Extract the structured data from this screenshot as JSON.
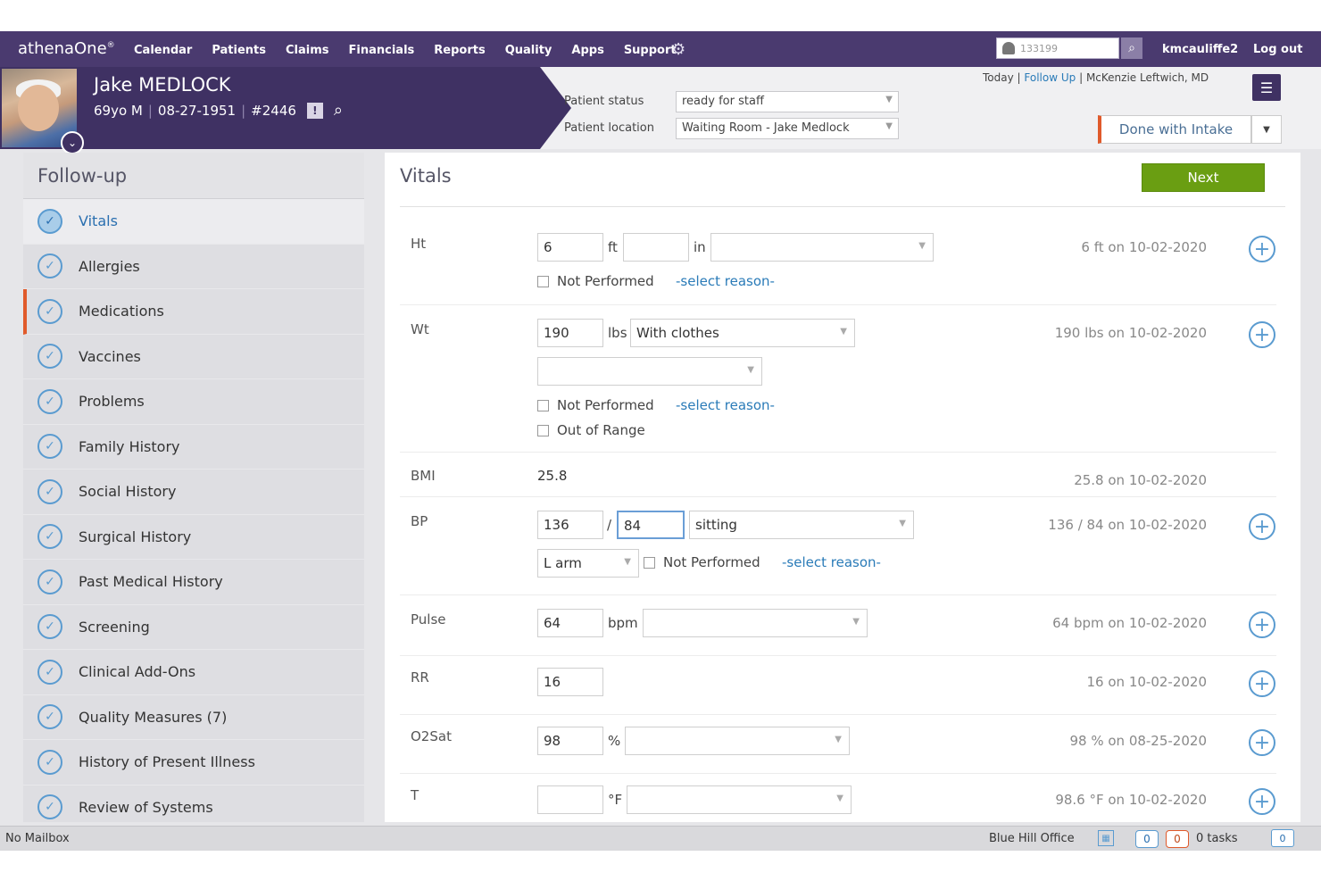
{
  "topbar": {
    "logo": "athenaOne",
    "nav": [
      "Calendar",
      "Patients",
      "Claims",
      "Financials",
      "Reports",
      "Quality",
      "Apps",
      "Support"
    ],
    "search_value": "133199",
    "username": "kmcauliffe2",
    "logout": "Log out"
  },
  "patient": {
    "name": "Jake MEDLOCK",
    "age_sex": "69yo M",
    "dob": "08-27-1951",
    "id": "#2446",
    "status_label": "Patient status",
    "status_value": "ready for staff",
    "location_label": "Patient location",
    "location_value": "Waiting Room - Jake Medlock"
  },
  "crumbs": {
    "today": "Today",
    "followup": "Follow Up",
    "provider": "McKenzie Leftwich, MD"
  },
  "done_button": "Done with Intake",
  "sidebar": {
    "title": "Follow-up",
    "items": [
      {
        "label": "Vitals"
      },
      {
        "label": "Allergies"
      },
      {
        "label": "Medications"
      },
      {
        "label": "Vaccines"
      },
      {
        "label": "Problems"
      },
      {
        "label": "Family History"
      },
      {
        "label": "Social History"
      },
      {
        "label": "Surgical History"
      },
      {
        "label": "Past Medical History"
      },
      {
        "label": "Screening"
      },
      {
        "label": "Clinical Add-Ons"
      },
      {
        "label": "Quality Measures  (7)"
      },
      {
        "label": "History of Present Illness"
      },
      {
        "label": "Review of Systems"
      }
    ]
  },
  "main": {
    "title": "Vitals",
    "next": "Next",
    "not_performed": "Not Performed",
    "select_reason": "-select reason-",
    "ht": {
      "label": "Ht",
      "ft": "6",
      "ft_unit": "ft",
      "in": "",
      "in_unit": "in",
      "history": "6 ft on 10-02-2020"
    },
    "wt": {
      "label": "Wt",
      "value": "190",
      "unit": "lbs",
      "clothing": "With clothes",
      "out_of_range": "Out of Range",
      "history": "190 lbs on 10-02-2020"
    },
    "bmi": {
      "label": "BMI",
      "value": "25.8",
      "history": "25.8 on 10-02-2020"
    },
    "bp": {
      "label": "BP",
      "systolic": "136",
      "slash": "/",
      "diastolic": "84",
      "position": "sitting",
      "site": "L arm",
      "history": "136 / 84 on 10-02-2020"
    },
    "pulse": {
      "label": "Pulse",
      "value": "64",
      "unit": "bpm",
      "history": "64 bpm on 10-02-2020"
    },
    "rr": {
      "label": "RR",
      "value": "16",
      "history": "16 on 10-02-2020"
    },
    "o2sat": {
      "label": "O2Sat",
      "value": "98",
      "unit": "%",
      "history": "98 % on 08-25-2020"
    },
    "temp": {
      "label": "T",
      "value": "",
      "unit": "°F",
      "history": "98.6 °F on 10-02-2020"
    }
  },
  "statusbar": {
    "mailbox": "No Mailbox",
    "office": "Blue Hill Office",
    "count_blue": "0",
    "count_orange": "0",
    "tasks": "0 tasks",
    "chat": "0"
  }
}
